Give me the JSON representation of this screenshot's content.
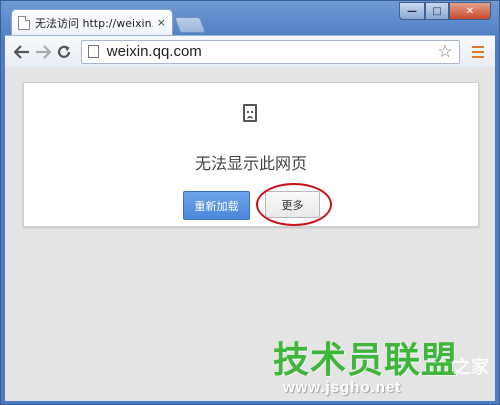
{
  "tab": {
    "title": "无法访问 http://weixin.qq",
    "close": "×"
  },
  "window_controls": {
    "minimize": "—",
    "maximize": "□",
    "close": "✕"
  },
  "toolbar": {
    "back_icon": "arrow-left",
    "forward_icon": "arrow-right",
    "reload_icon": "reload",
    "url": "weixin.qq.com",
    "bookmark_icon": "star"
  },
  "error_page": {
    "icon": "sad-page",
    "title": "无法显示此网页",
    "reload_button": "重新加载",
    "more_button": "更多"
  },
  "annotation": {
    "highlight_color": "#c8141b"
  },
  "watermark": {
    "brand": "技术员联盟",
    "suffix": "之家",
    "url": "www.jsgho.net"
  }
}
